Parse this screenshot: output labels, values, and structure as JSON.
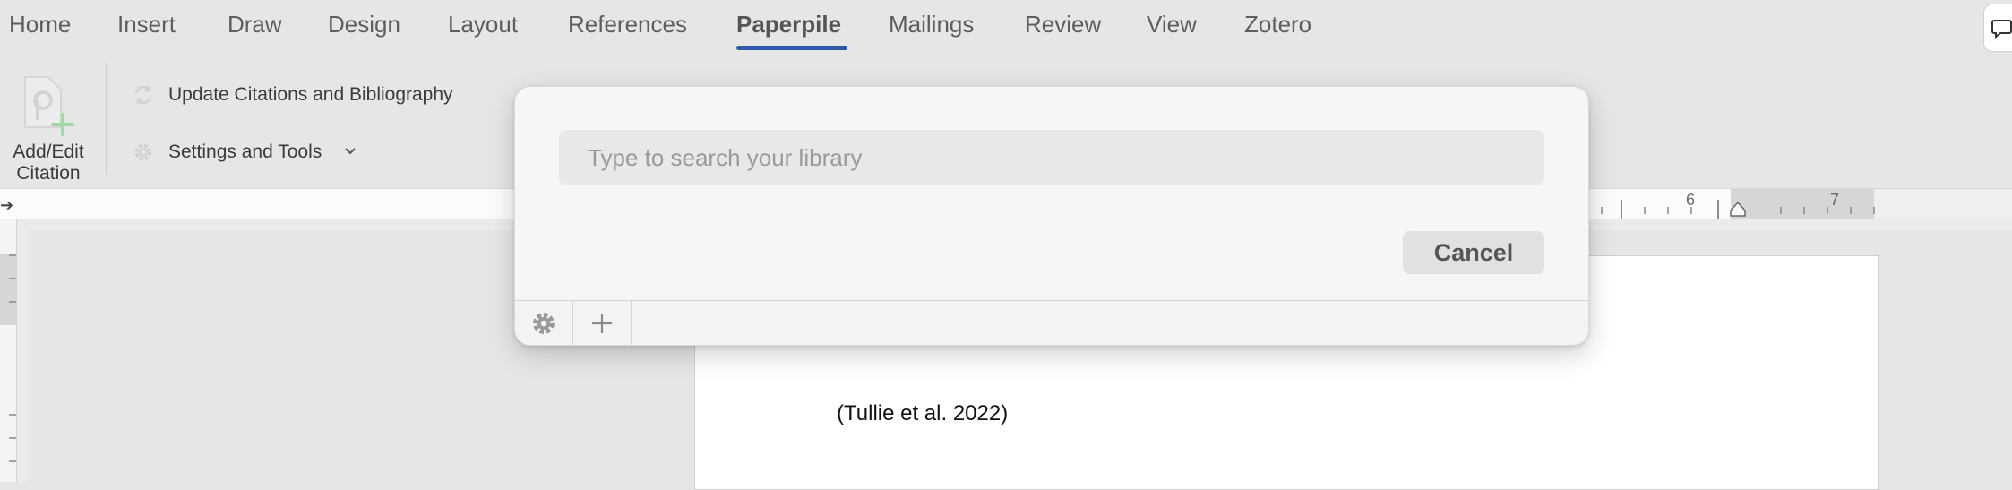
{
  "tabs": [
    {
      "label": "Home"
    },
    {
      "label": "Insert"
    },
    {
      "label": "Draw"
    },
    {
      "label": "Design"
    },
    {
      "label": "Layout"
    },
    {
      "label": "References"
    },
    {
      "label": "Paperpile"
    },
    {
      "label": "Mailings"
    },
    {
      "label": "Review"
    },
    {
      "label": "View"
    },
    {
      "label": "Zotero"
    }
  ],
  "active_tab": "Paperpile",
  "ribbon": {
    "add_edit_line1": "Add/Edit",
    "add_edit_line2": "Citation",
    "update_label": "Update Citations and Bibliography",
    "settings_label": "Settings and Tools"
  },
  "ruler": {
    "labels": [
      "6",
      "7"
    ]
  },
  "document": {
    "citation_text": "(Tullie et al. 2022)"
  },
  "dialog": {
    "search_placeholder": "Type to search your library",
    "search_value": "",
    "cancel_label": "Cancel"
  },
  "colors": {
    "accent": "#2a5aa8",
    "plus_green": "#5bc46a"
  },
  "icons": {
    "add_edit": "document-plus-icon",
    "update": "refresh-icon",
    "settings": "gear-icon",
    "footer_settings": "gear-icon",
    "footer_add": "plus-icon",
    "comment": "comment-icon"
  }
}
